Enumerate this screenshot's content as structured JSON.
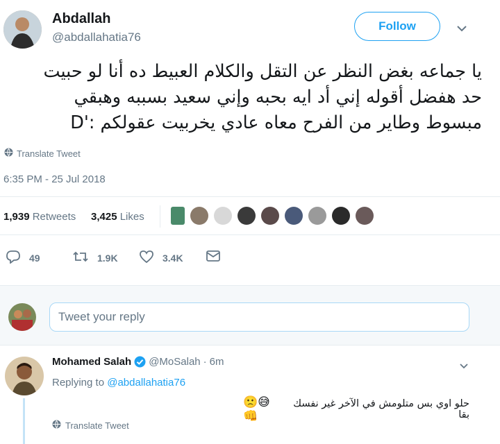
{
  "tweet": {
    "author_name": "Abdallah",
    "author_handle": "@abdallahatia76",
    "follow_label": "Follow",
    "text_lines": [
      "يا جماعه بغض النظر عن التقل والكلام العبيط ده أنا لو حبيت",
      "حد هفضل أقوله إني أد ايه بحبه وإني سعيد بسببه وهبقي",
      "مبسوط وطاير من الفرح معاه عادي يخربيت عقولكم :'D"
    ],
    "translate_label": "Translate Tweet",
    "timestamp": "6:35 PM - 25 Jul 2018",
    "retweets_count": "1,939",
    "retweets_label": "Retweets",
    "likes_count": "3,425",
    "likes_label": "Likes",
    "reply_count": "49",
    "retweet_action_count": "1.9K",
    "like_action_count": "3.4K"
  },
  "liker_avatars": [
    {
      "icon": "avatar-1",
      "color": "#4a8a6a"
    },
    {
      "icon": "avatar-2",
      "color": "#8a7a6a"
    },
    {
      "icon": "avatar-3",
      "color": "#d8d8d8"
    },
    {
      "icon": "avatar-4",
      "color": "#3a3a3a"
    },
    {
      "icon": "avatar-5",
      "color": "#5a4a4a"
    },
    {
      "icon": "avatar-6",
      "color": "#4a5a7a"
    },
    {
      "icon": "avatar-7",
      "color": "#9a9a9a"
    },
    {
      "icon": "avatar-8",
      "color": "#2a2a2a"
    },
    {
      "icon": "avatar-9",
      "color": "#6a5a5a"
    }
  ],
  "reply_composer": {
    "placeholder": "Tweet your reply"
  },
  "reply": {
    "author_name": "Mohamed Salah",
    "author_handle": "@MoSalah",
    "separator": "·",
    "time": "6m",
    "replying_prefix": "Replying to",
    "replying_to": "@abdallahatia76",
    "text": "حلو اوي بس متلومش في الآخر غير نفسك بقا",
    "emojis": "🙁😅👊",
    "translate_label": "Translate Tweet"
  },
  "colors": {
    "accent": "#1da1f2",
    "secondary_text": "#657786",
    "divider": "#e6ecf0",
    "verified_badge": "#1da1f2"
  }
}
